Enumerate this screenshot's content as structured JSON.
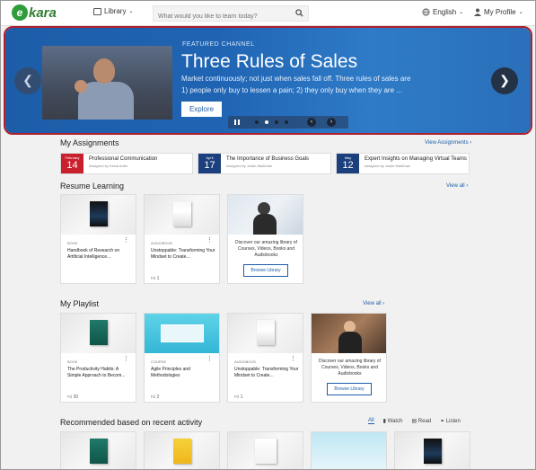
{
  "header": {
    "logo_text": "kara",
    "library_label": "Library",
    "search_placeholder": "What would you like to learn today?",
    "language_label": "English",
    "profile_label": "My Profile"
  },
  "hero": {
    "featured_label": "FEATURED CHANNEL",
    "title": "Three Rules of Sales",
    "description": "Market continuously; not just when sales fall off. Three rules of sales are 1) people only buy to lessen a pain; 2) they only buy when they are ...",
    "explore_label": "Explore",
    "slide_count": 4,
    "active_slide": 2
  },
  "assignments": {
    "title": "My Assignments",
    "view_label": "View Assignments",
    "items": [
      {
        "month": "February",
        "day": "14",
        "title": "Professional Communication",
        "sub": "Assigned by Kezia Adler",
        "color": "#c8202c"
      },
      {
        "month": "April",
        "day": "17",
        "title": "The Importance of Business Goals",
        "sub": "Assigned by Justin Markham",
        "color": "#1c3f7d"
      },
      {
        "month": "May",
        "day": "12",
        "title": "Expert Insights on Managing Virtual Teams",
        "sub": "Assigned by Justin Markham",
        "color": "#1c3f7d"
      }
    ]
  },
  "resume": {
    "title": "Resume Learning",
    "view_label": "View all",
    "cards": [
      {
        "type": "BOOK",
        "title": "Handbook of Research on Artificial Intelligence...",
        "likes": ""
      },
      {
        "type": "AUDIOBOOK",
        "title": "Unstoppable: Transforming Your Mindset to Create...",
        "likes": "1"
      }
    ],
    "promo_text": "Discover our amazing library of Courses, Videos, Books and Audiobooks",
    "promo_button": "Browse Library"
  },
  "playlist": {
    "title": "My Playlist",
    "view_label": "View all",
    "cards": [
      {
        "type": "BOOK",
        "title": "The Productivity Habits: A Simple Approach to Becom...",
        "likes": "30"
      },
      {
        "type": "COURSE",
        "title": "Agile Principles and Methodologies",
        "likes": "2"
      },
      {
        "type": "AUDIOBOOK",
        "title": "Unstoppable: Transforming Your Mindset to Create...",
        "likes": "1"
      }
    ],
    "promo_text": "Discover our amazing library of Courses, Videos, Books and Audiobooks",
    "promo_button": "Browse Library"
  },
  "recommended": {
    "title": "Recommended based on recent activity",
    "tabs": [
      "All",
      "Watch",
      "Read",
      "Listen"
    ],
    "active_tab": "All"
  },
  "icons": {
    "library": "library-icon",
    "search": "search-icon",
    "globe": "globe-icon",
    "user": "user-icon",
    "like": "thumbs-up-icon"
  },
  "colors": {
    "accent": "#1d5da8",
    "hero_border": "#b0212e",
    "logo_green": "#2e9d3a"
  }
}
